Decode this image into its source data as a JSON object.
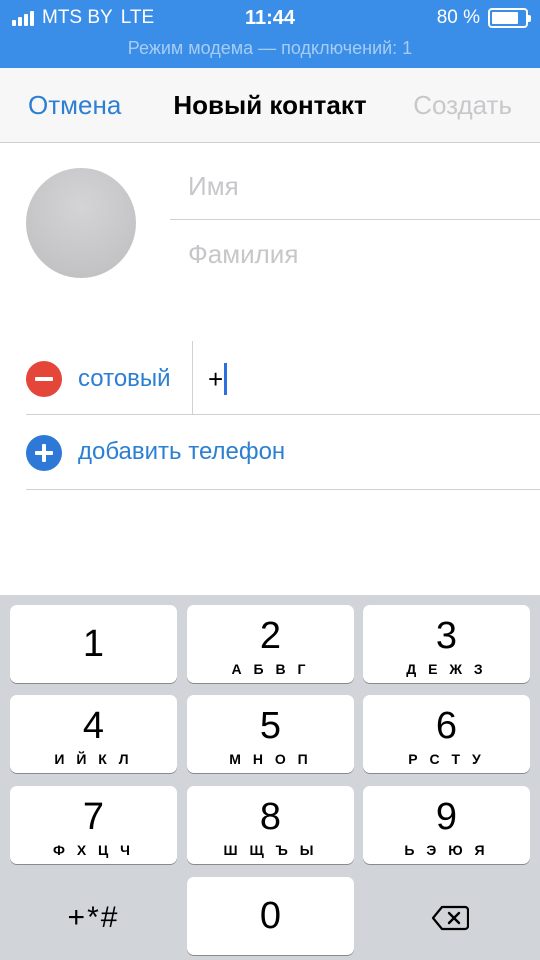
{
  "status_bar": {
    "carrier": "MTS BY",
    "network": "LTE",
    "time": "11:44",
    "battery": "80 %",
    "battery_level": 0.8,
    "hotspot_text": "Режим модема — подключений: 1"
  },
  "nav": {
    "cancel": "Отмена",
    "title": "Новый контакт",
    "create": "Создать"
  },
  "form": {
    "first_name_placeholder": "Имя",
    "last_name_placeholder": "Фамилия",
    "phone_label": "сотовый",
    "phone_value": "+",
    "add_phone": "добавить телефон"
  },
  "keypad": {
    "keys": [
      {
        "digit": "1",
        "letters": ""
      },
      {
        "digit": "2",
        "letters": "А Б В Г"
      },
      {
        "digit": "3",
        "letters": "Д Е Ж З"
      },
      {
        "digit": "4",
        "letters": "И Й К Л"
      },
      {
        "digit": "5",
        "letters": "М Н О П"
      },
      {
        "digit": "6",
        "letters": "Р С Т У"
      },
      {
        "digit": "7",
        "letters": "Ф Х Ц Ч"
      },
      {
        "digit": "8",
        "letters": "Ш Щ Ъ Ы"
      },
      {
        "digit": "9",
        "letters": "Ь Э Ю Я"
      },
      {
        "digit": "+*#",
        "letters": ""
      },
      {
        "digit": "0",
        "letters": ""
      }
    ],
    "delete_icon": "delete-backspace-icon"
  },
  "colors": {
    "status_bar": "#3a8ee8",
    "accent": "#2c7fd2",
    "remove": "#e5463a",
    "add": "#2e78d8",
    "keypad_bg": "#d1d4d9"
  }
}
